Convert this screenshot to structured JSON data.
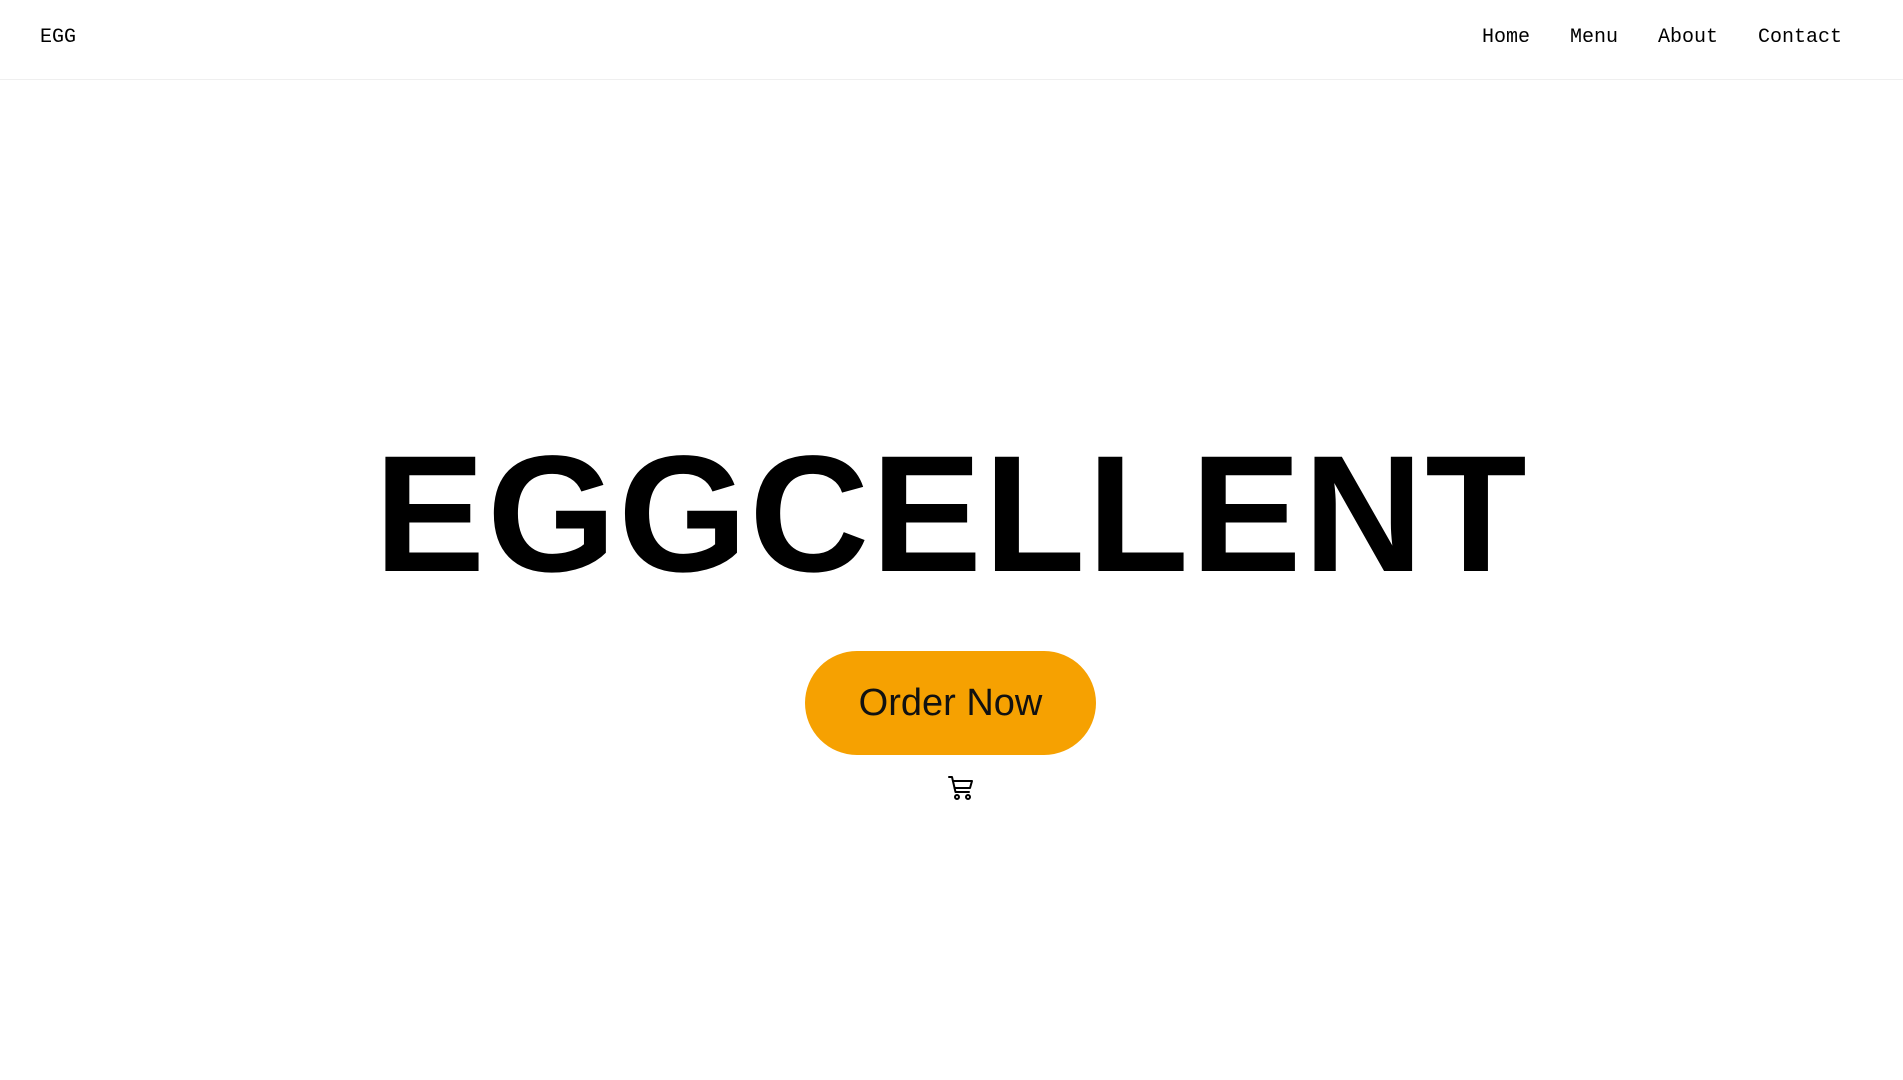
{
  "header": {
    "brand": "EGG",
    "nav": [
      {
        "label": "Home"
      },
      {
        "label": "Menu"
      },
      {
        "label": "About"
      },
      {
        "label": "Contact"
      }
    ]
  },
  "hero": {
    "title": "EGGCELLENT",
    "order_button": {
      "label": "Order Now",
      "color": "#F6A101"
    },
    "icon": "shopping-cart-icon"
  }
}
